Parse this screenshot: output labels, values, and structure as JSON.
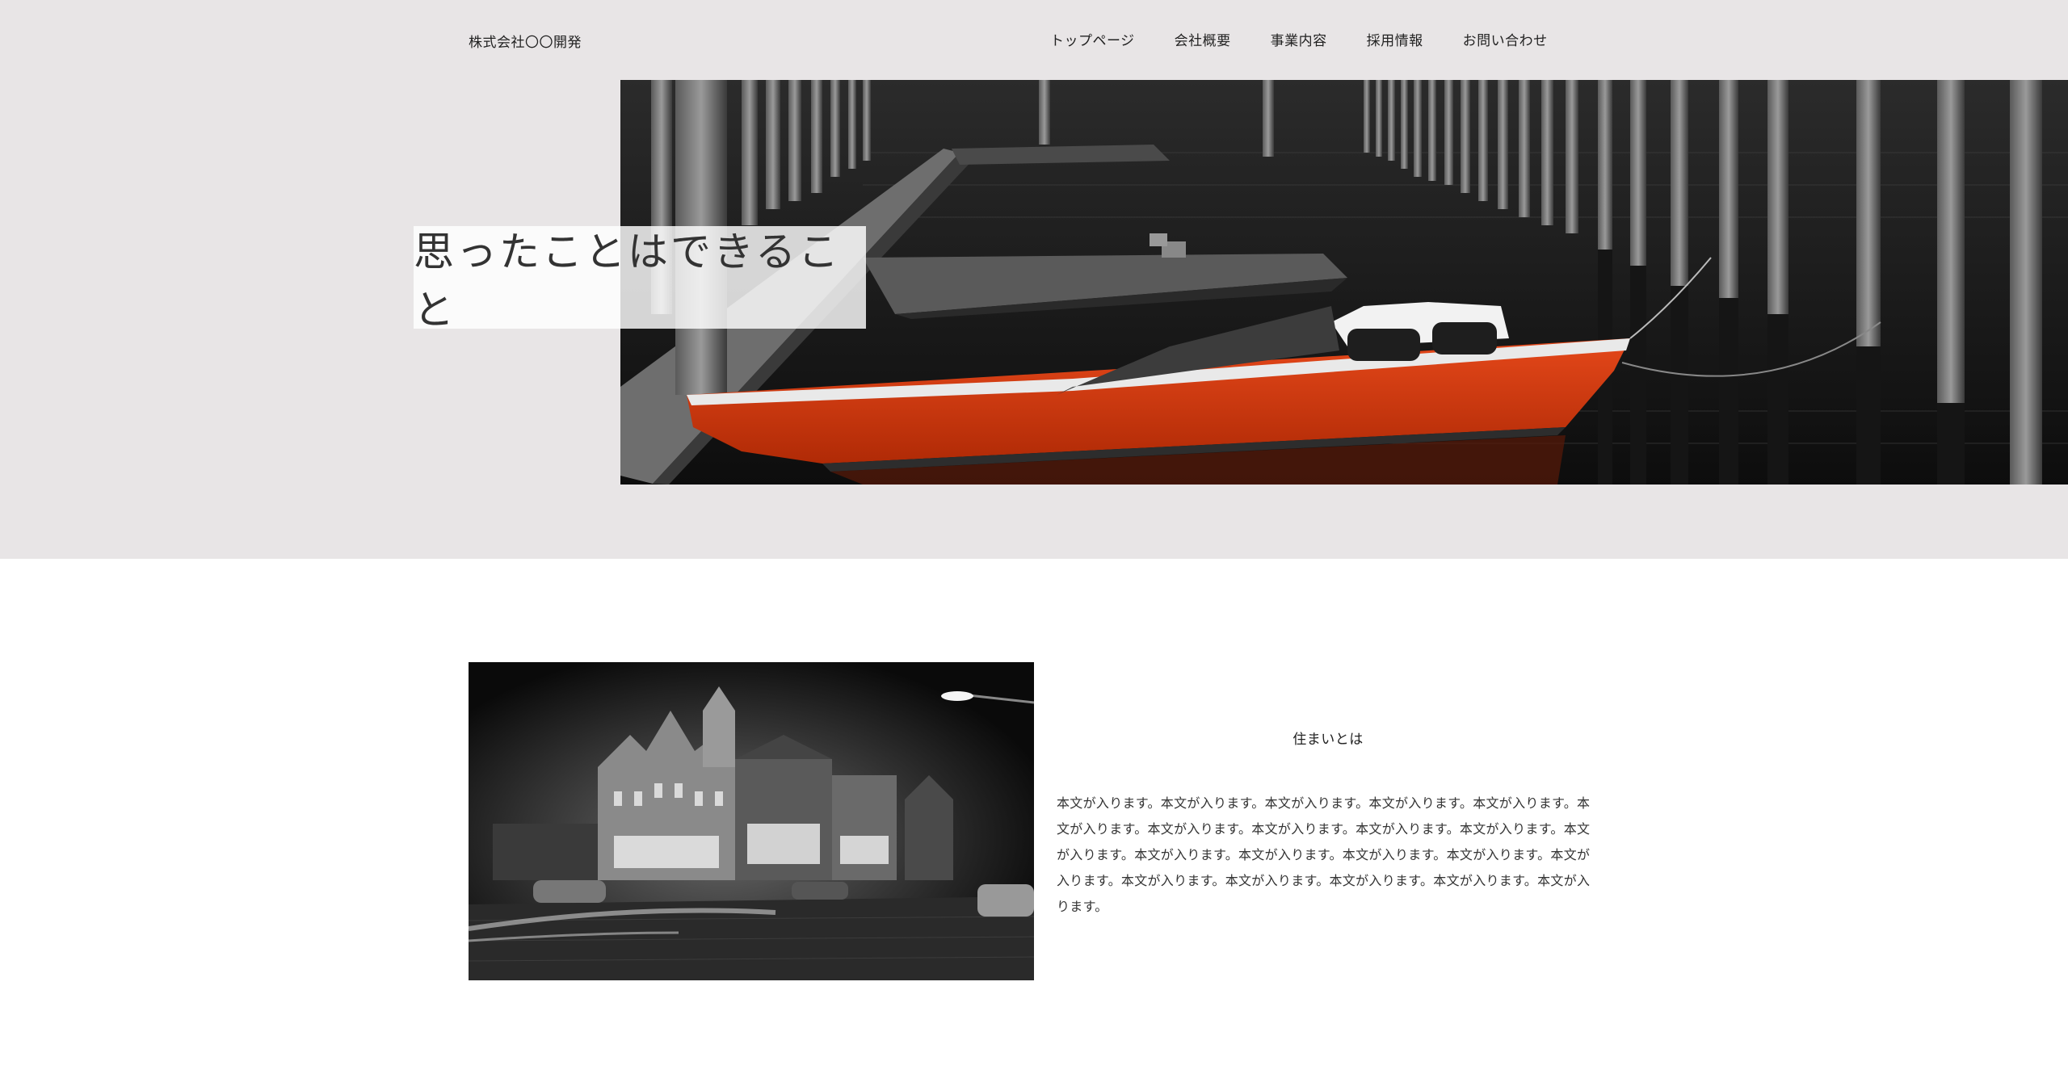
{
  "header": {
    "company_name": "株式会社〇〇開発",
    "nav": [
      {
        "label": "トップページ"
      },
      {
        "label": "会社概要"
      },
      {
        "label": "事業内容"
      },
      {
        "label": "採用情報"
      },
      {
        "label": "お問い合わせ"
      }
    ]
  },
  "hero": {
    "title": "思ったことはできること"
  },
  "about": {
    "heading": "住まいとは",
    "body": "本文が入ります。本文が入ります。本文が入ります。本文が入ります。本文が入ります。本文が入ります。本文が入ります。本文が入ります。本文が入ります。本文が入ります。本文が入ります。本文が入ります。本文が入ります。本文が入ります。本文が入ります。本文が入ります。本文が入ります。本文が入ります。本文が入ります。本文が入ります。本文が入ります。"
  },
  "colors": {
    "header_bg": "#e8e5e6",
    "boat_red": "#d83a0e",
    "text": "#222222"
  }
}
